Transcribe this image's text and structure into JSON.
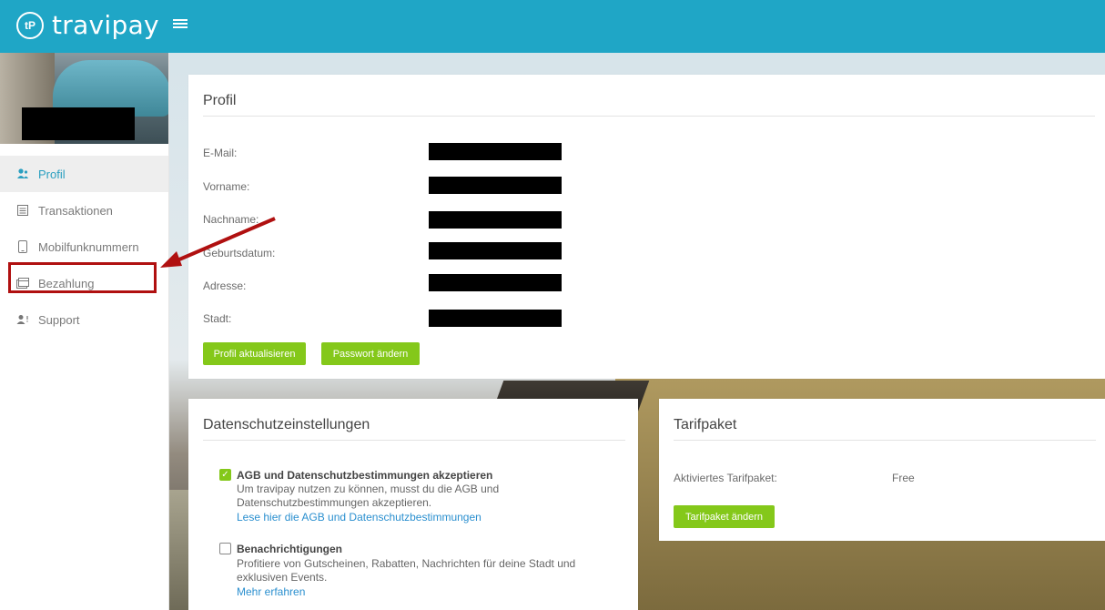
{
  "header": {
    "logo_mark": "tP",
    "app_name": "travipay",
    "menu_icon": "hamburger-icon"
  },
  "sidebar": {
    "items": [
      {
        "label": "Profil",
        "icon": "profile-icon",
        "active": true
      },
      {
        "label": "Transaktionen",
        "icon": "list-icon",
        "active": false
      },
      {
        "label": "Mobilfunknummern",
        "icon": "phone-icon",
        "active": false
      },
      {
        "label": "Bezahlung",
        "icon": "card-icon",
        "active": false
      },
      {
        "label": "Support",
        "icon": "support-icon",
        "active": false
      }
    ]
  },
  "profile": {
    "title": "Profil",
    "fields": [
      {
        "label": "E-Mail:"
      },
      {
        "label": "Vorname:"
      },
      {
        "label": "Nachname:"
      },
      {
        "label": "Geburtsdatum:"
      },
      {
        "label": "Adresse:"
      },
      {
        "label": "Stadt:"
      }
    ],
    "update_button": "Profil aktualisieren",
    "password_button": "Passwort ändern"
  },
  "privacy": {
    "title": "Datenschutzeinstellungen",
    "agb": {
      "title": "AGB und Datenschutzbestimmungen akzeptieren",
      "desc_line1": "Um travipay nutzen zu können, musst du die AGB und",
      "desc_line2": "Datenschutzbestimmungen akzeptieren.",
      "link": "Lese hier die AGB und Datenschutzbestimmungen",
      "checked": true
    },
    "notifications": {
      "title": "Benachrichtigungen",
      "desc_line1": "Profitiere von Gutscheinen, Rabatten, Nachrichten für deine Stadt und",
      "desc_line2": "exklusiven Events.",
      "link": "Mehr erfahren",
      "checked": false
    }
  },
  "tariff": {
    "title": "Tarifpaket",
    "label": "Aktiviertes Tarifpaket:",
    "value": "Free",
    "button": "Tarifpaket ändern"
  },
  "colors": {
    "topbar": "#1fa6c6",
    "accent_green": "#84c81a",
    "highlight_red": "#b01010"
  }
}
